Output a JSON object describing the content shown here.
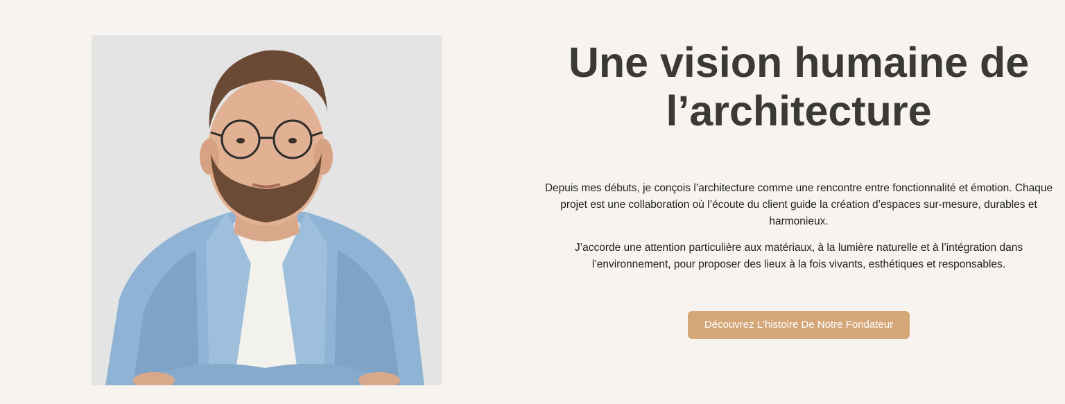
{
  "about": {
    "heading_line1": "Une vision humaine de",
    "heading_line2": "l’architecture",
    "paragraph1": "Depuis mes débuts, je conçois l’architecture comme une rencontre entre fonctionnalité et émotion. Chaque projet est une collaboration où l’écoute du client guide la création d’espaces sur-mesure, durables et harmonieux.",
    "paragraph2": "J’accorde une attention particulière aux matériaux, à la lumière naturelle et à l’intégration dans l’environnement, pour proposer des lieux à la fois vivants, esthétiques et responsables.",
    "cta_label": "Découvrez L'histoire De Notre Fondateur"
  },
  "colors": {
    "background": "#f7f4ef",
    "heading": "#3b3935",
    "button": "#d4a678",
    "button_text": "#ffffff"
  }
}
